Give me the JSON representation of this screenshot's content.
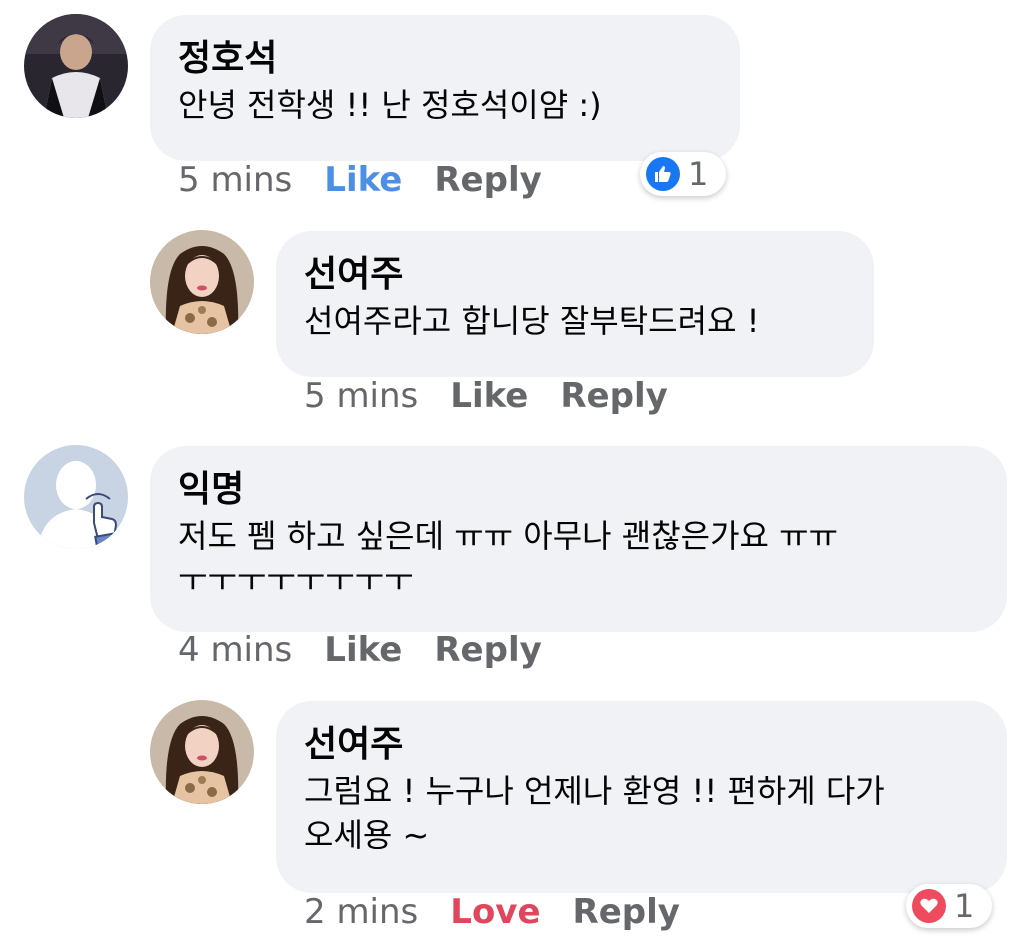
{
  "comments": [
    {
      "author": "정호석",
      "text": "안녕 전학생 !! 난 정호석이얌 :)",
      "time": "5 mins",
      "like": "Like",
      "reply": "Reply",
      "reaction_count": "1",
      "reaction": "like-icon",
      "reaction_color": "#1877f2"
    },
    {
      "author": "선여주",
      "text": "선여주라고 합니당 잘부탁드려요 !",
      "time": "5 mins",
      "like": "Like",
      "reply": "Reply"
    },
    {
      "author": "익명",
      "text": "저도 펨 하고 싶은데 ㅠㅠ 아무나 괜찮은가요 ㅠㅠ\nㅜㅜㅜㅜㅜㅜㅜㅜ",
      "time": "4 mins",
      "like": "Like",
      "reply": "Reply"
    },
    {
      "author": "선여주",
      "text": "그럼요 ! 누구나 언제나 환영 !! 편하게 다가\n오세용 ~",
      "time": "2 mins",
      "love": "Love",
      "reply": "Reply",
      "reaction_count": "1",
      "reaction": "heart-icon",
      "reaction_color": "#ef4b5e"
    }
  ],
  "colors": {
    "bubble": "#f0f2f5",
    "like_active": "#4d8fe5",
    "love_active": "#e0475e",
    "meta": "#65676b"
  }
}
